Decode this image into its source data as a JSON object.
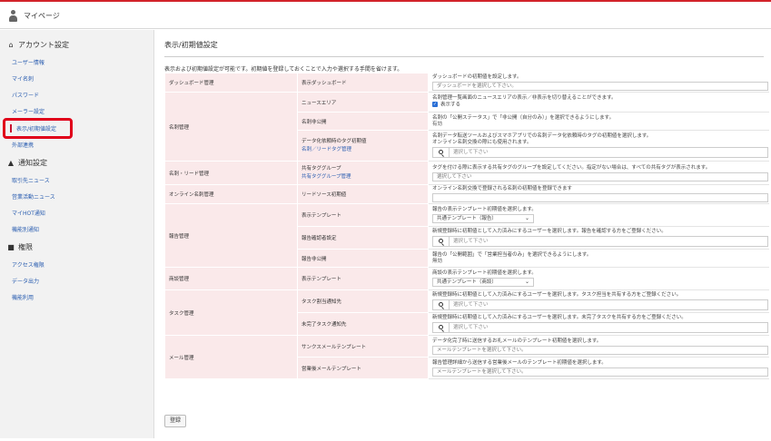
{
  "topbar": {
    "title": "マイページ"
  },
  "sidebar": {
    "account_title": "アカウント設定",
    "account_items": [
      "ユーザー情報",
      "マイ名刺",
      "パスワード",
      "メーラー設定",
      "表示/初期値設定",
      "外部連携"
    ],
    "notify_title": "通知設定",
    "notify_items": [
      "取引先ニュース",
      "営業活動ニュース",
      "マイHOT通知",
      "機能別通知"
    ],
    "perm_title": "権限",
    "perm_items": [
      "アクセス権限",
      "データ出力",
      "機能利用"
    ]
  },
  "main": {
    "title": "表示/初期値設定",
    "description": "表示および初期値設定が可能です。初期値を登録しておくことで入力や選択する手間を省けます。",
    "save_label": "登録"
  },
  "rows": {
    "dash": {
      "group": "ダッシュボード管理",
      "name": "表示ダッシュボード",
      "desc": "ダッシュボードの初期値を設定します。",
      "placeholder": "ダッシュボードを選択して下さい。"
    },
    "news": {
      "group": "名刺管理",
      "name": "ニュースエリア",
      "desc": "名刺管理一覧画面のニュースエリアの表示／非表示を切り替えることができます。",
      "check_label": "表示する"
    },
    "private": {
      "name": "名刺非公開",
      "desc": "名刺の「公開ステータス」で「非公開（自分のみ）」を選択できるようにします。",
      "status": "有効"
    },
    "tag": {
      "name": "データ化依頼時のタグ初期値",
      "sub": "名刺／リードタグ管理",
      "desc1": "名刺データ転送ツールおよびスマホアプリでの名刺データ化依頼時のタグの初期値を選択します。",
      "desc2": "オンライン名刺交換の際にも使用されます。",
      "placeholder": "選択して下さい"
    },
    "shared": {
      "group": "名刺・リード管理",
      "name": "共有タググループ",
      "sub": "共有タググループ管理",
      "desc": "タグを付ける際に表示する共有タグのグループを設定してください。指定がない場合は、すべての共有タグが表示されます。",
      "placeholder": "選択して下さい"
    },
    "online": {
      "group": "オンライン名刺管理",
      "name": "リードソース初期値",
      "desc": "オンライン名刺交換で登録される名刺の初期値を登録できます"
    },
    "report_tpl": {
      "group": "報告管理",
      "name": "表示テンプレート",
      "desc": "報告の表示テンプレート初期値を選択します。",
      "selected": "共通テンプレート（報告）"
    },
    "report_confirm": {
      "name": "報告確認者設定",
      "desc": "新規登録時に初期値として入力済みにするユーザーを選択します。報告を確認する方をご登録ください。",
      "placeholder": "選択して下さい"
    },
    "report_private": {
      "name": "報告非公開",
      "desc": "報告の「公開範囲」で「営業担当者のみ」を選択できるようにします。",
      "status": "無効"
    },
    "deal_tpl": {
      "group": "商談管理",
      "name": "表示テンプレート",
      "desc": "商談の表示テンプレート初期値を選択します。",
      "selected": "共通テンプレート（商談）"
    },
    "task_notify": {
      "group": "タスク管理",
      "name": "タスク割当通知先",
      "desc": "新規登録時に初期値として入力済みにするユーザーを選択します。タスク担当を共有する方をご登録ください。",
      "placeholder": "選択して下さい"
    },
    "task_incomplete": {
      "name": "未完了タスク通知先",
      "desc": "新規登録時に初期値として入力済みにするユーザーを選択します。未完了タスクを共有する方をご登録ください。",
      "placeholder": "選択して下さい"
    },
    "mail_thanks": {
      "group": "メール管理",
      "name": "サンクスメールテンプレート",
      "desc": "データ化完了時に送信するお礼メールのテンプレート初期値を選択します。",
      "placeholder": "メールテンプレートを選択して下さい。"
    },
    "mail_sales": {
      "name": "営業後メールテンプレート",
      "desc": "報告管理詳細から送信する営業後メールのテンプレート初期値を選択します。",
      "placeholder": "メールテンプレートを選択して下さい。"
    }
  },
  "icons": {
    "user": "person-icon",
    "account": "home-icon",
    "notify": "bell-icon",
    "perm": "lock-icon",
    "search": "search-icon",
    "chevron": "chevron-down-icon"
  },
  "colors": {
    "accent": "#d2232a",
    "label_bg": "#fae9ea",
    "link": "#2a5db0",
    "sidebar_bg": "#f2f2f2"
  }
}
